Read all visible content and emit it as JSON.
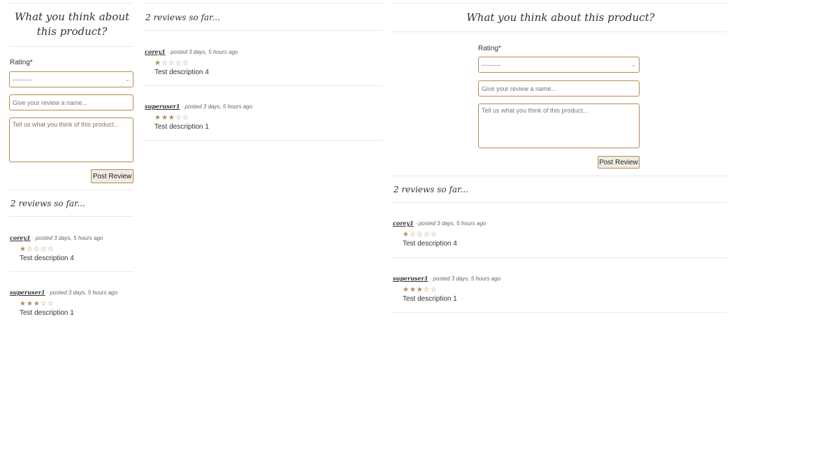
{
  "form": {
    "title": "What you think about this product?",
    "rating_label": "Rating*",
    "rating_placeholder": "---------",
    "name_placeholder": "Give your review a name...",
    "desc_placeholder": "Tell us what you think of this product...",
    "submit_label": "Post Review"
  },
  "reviews": {
    "heading": "2 reviews so far...",
    "items": [
      {
        "user": "corey1",
        "meta": " · posted 3 days, 5 hours ago",
        "stars": "★☆☆☆☆",
        "rating": 1,
        "description": "Test description 4"
      },
      {
        "user": "superuser1",
        "meta": " · posted 3 days, 5 hours ago",
        "stars": "★★★☆☆",
        "rating": 3,
        "description": "Test description 1"
      }
    ]
  },
  "colors": {
    "accent": "#b08d57"
  }
}
